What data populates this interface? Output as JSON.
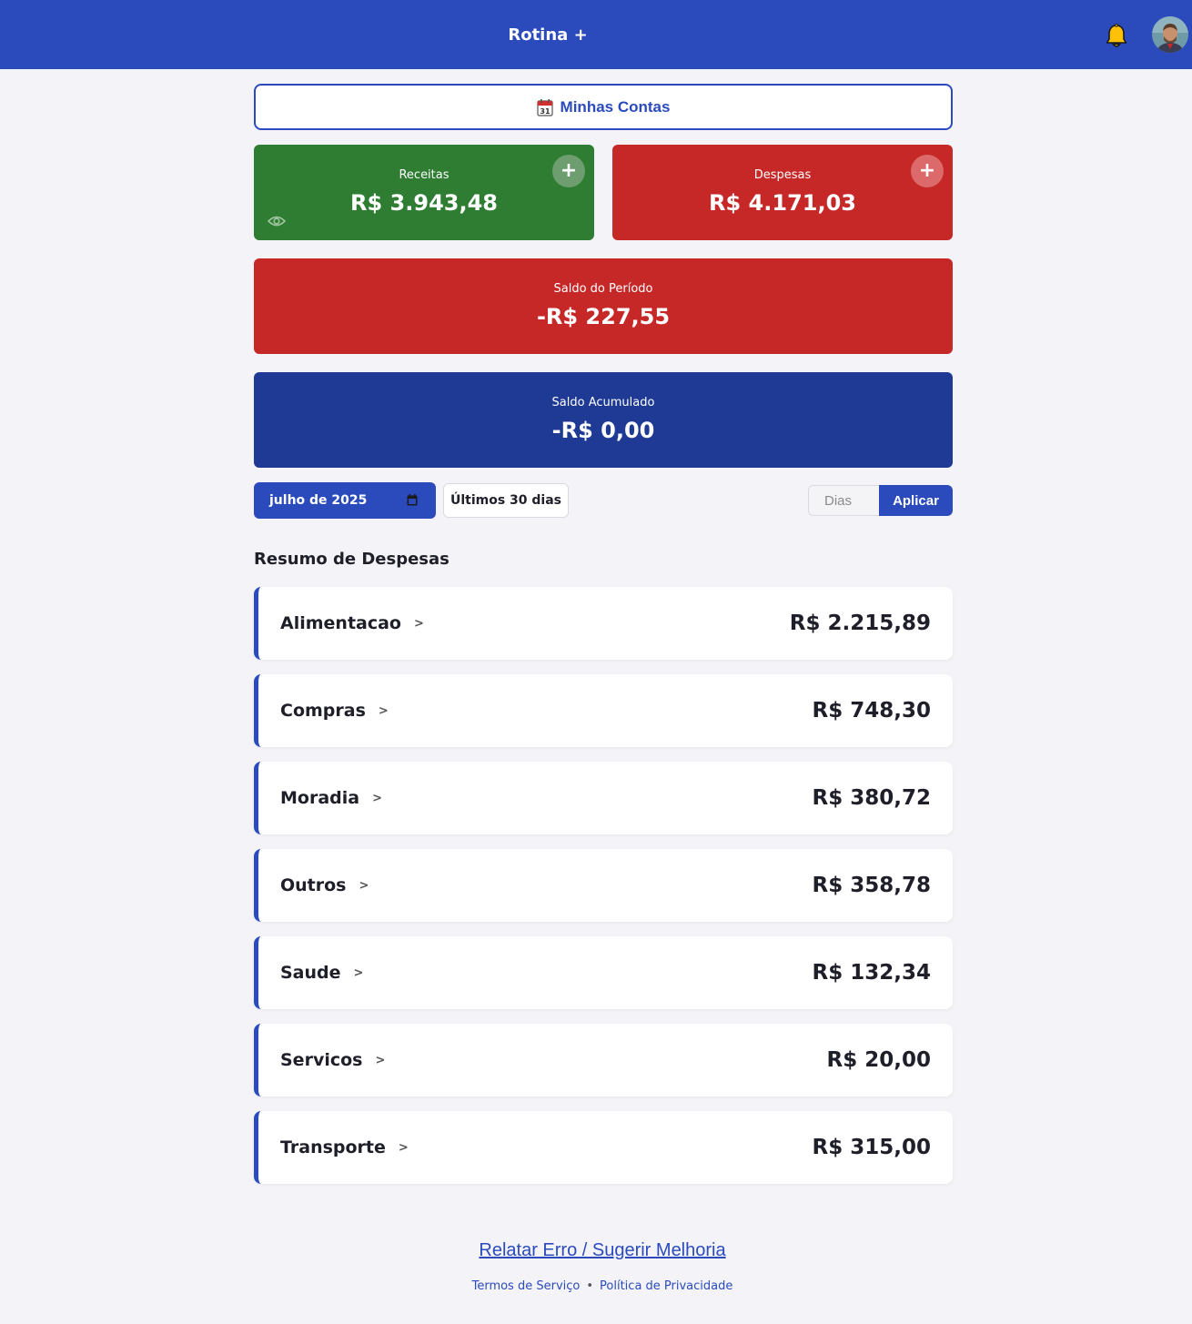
{
  "header": {
    "title": "Rotina +",
    "bell_icon": "bell-icon",
    "avatar_icon": "user-avatar"
  },
  "contas": {
    "label": "Minhas Contas",
    "icon": "calendar-icon"
  },
  "cards": {
    "receitas": {
      "label": "Receitas",
      "value": "R$ 3.943,48",
      "color": "#2e7d32"
    },
    "despesas": {
      "label": "Despesas",
      "value": "R$ 4.171,03",
      "color": "#c62828"
    },
    "saldo_periodo": {
      "label": "Saldo do Período",
      "value": "-R$ 227,55",
      "color": "#c62828"
    },
    "saldo_acumulado": {
      "label": "Saldo Acumulado",
      "value": "-R$ 0,00",
      "color": "#1e3a94"
    }
  },
  "filters": {
    "month": "julho de 2025",
    "last30": "Últimos 30 dias",
    "dias_placeholder": "Dias",
    "apply": "Aplicar"
  },
  "resumo": {
    "title": "Resumo de Despesas",
    "items": [
      {
        "name": "Alimentacao",
        "value": "R$ 2.215,89"
      },
      {
        "name": "Compras",
        "value": "R$ 748,30"
      },
      {
        "name": "Moradia",
        "value": "R$ 380,72"
      },
      {
        "name": "Outros",
        "value": "R$ 358,78"
      },
      {
        "name": "Saude",
        "value": "R$ 132,34"
      },
      {
        "name": "Servicos",
        "value": "R$ 20,00"
      },
      {
        "name": "Transporte",
        "value": "R$ 315,00"
      }
    ]
  },
  "footer": {
    "report": "Relatar Erro / Sugerir Melhoria",
    "terms": "Termos de Serviço",
    "separator": "•",
    "privacy": "Política de Privacidade"
  },
  "colors": {
    "primary": "#2b4bbd",
    "income": "#2e7d32",
    "expense": "#c62828",
    "accumulated": "#1e3a94"
  }
}
